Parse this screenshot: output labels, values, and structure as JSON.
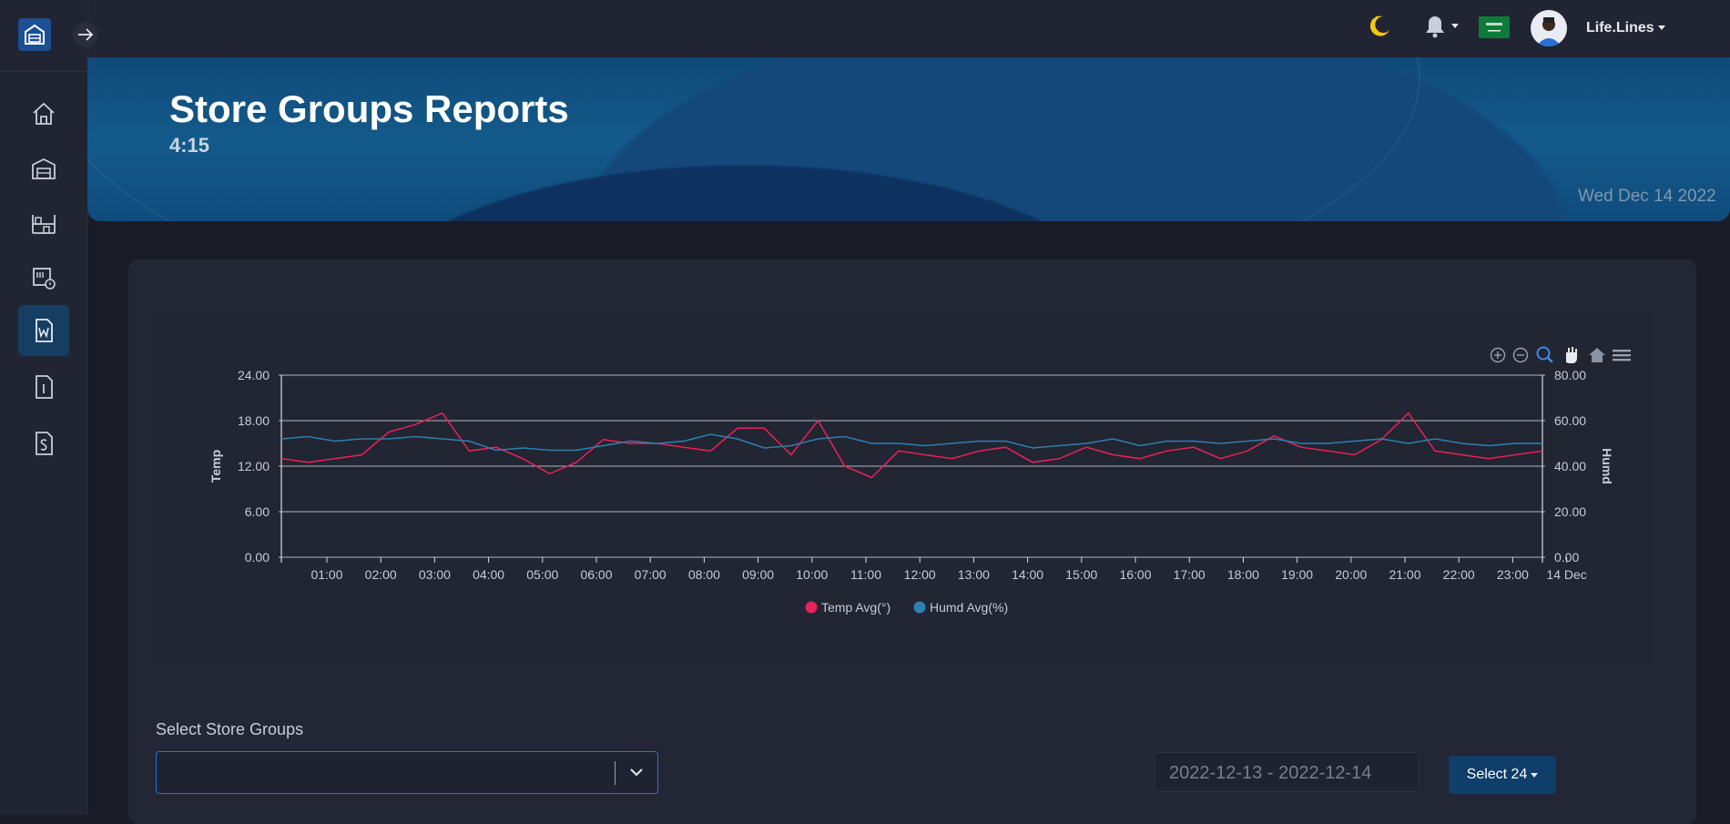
{
  "header": {
    "user_name": "Life.Lines",
    "icons": [
      "moon-icon",
      "bell-icon",
      "flag-icon",
      "avatar",
      "menu-toggle-icon"
    ]
  },
  "sidebar": {
    "items": [
      {
        "icon": "home-icon",
        "active": false
      },
      {
        "icon": "warehouse-icon",
        "active": false
      },
      {
        "icon": "storage-icon",
        "active": false
      },
      {
        "icon": "devices-icon",
        "active": false
      },
      {
        "icon": "report-w-icon",
        "active": true
      },
      {
        "icon": "report-i-icon",
        "active": false
      },
      {
        "icon": "report-s-icon",
        "active": false
      }
    ]
  },
  "banner": {
    "title": "Store Groups Reports",
    "time": "4:15",
    "date": "Wed Dec 14 2022"
  },
  "chart_data": {
    "type": "line",
    "x": [
      "01:00",
      "02:00",
      "03:00",
      "04:00",
      "05:00",
      "06:00",
      "07:00",
      "08:00",
      "09:00",
      "10:00",
      "11:00",
      "12:00",
      "13:00",
      "14:00",
      "15:00",
      "16:00",
      "17:00",
      "18:00",
      "19:00",
      "20:00",
      "21:00",
      "22:00",
      "23:00",
      "14 Dec"
    ],
    "y_left": {
      "label": "Temp",
      "ticks": [
        "24.00",
        "18.00",
        "12.00",
        "6.00",
        "0.00"
      ],
      "range": [
        0,
        24
      ]
    },
    "y_right": {
      "label": "Humd",
      "ticks": [
        "80.00",
        "60.00",
        "40.00",
        "20.00",
        "0.00"
      ],
      "range": [
        0,
        80
      ]
    },
    "series": [
      {
        "name": "Temp Avg(°)",
        "color": "#e8225a",
        "axis": "left",
        "values": [
          13.0,
          12.5,
          13.0,
          13.5,
          16.5,
          17.5,
          19.0,
          14.0,
          14.5,
          13.0,
          11.0,
          12.5,
          15.5,
          15.0,
          15.0,
          14.5,
          14.0,
          17.0,
          17.0,
          13.5,
          18.0,
          12.0,
          10.5,
          14.0,
          13.5,
          13.0,
          14.0,
          14.5,
          12.5,
          13.0,
          14.5,
          13.5,
          13.0,
          14.0,
          14.5,
          13.0,
          14.0,
          16.0,
          14.5,
          14.0,
          13.5,
          15.5,
          19.0,
          14.0,
          13.5,
          13.0,
          13.5,
          14.0
        ]
      },
      {
        "name": "Humd Avg(%)",
        "color": "#2f7fb0",
        "axis": "right",
        "values": [
          52,
          53,
          51,
          52,
          52,
          53,
          52,
          51,
          47,
          48,
          47,
          47,
          49,
          51,
          50,
          51,
          54,
          52,
          48,
          49,
          52,
          53,
          50,
          50,
          49,
          50,
          51,
          51,
          48,
          49,
          50,
          52,
          49,
          51,
          51,
          50,
          51,
          52,
          50,
          50,
          51,
          52,
          50,
          52,
          50,
          49,
          50,
          50
        ]
      }
    ],
    "toolbar": [
      "zoom-in-icon",
      "zoom-out-icon",
      "selection-zoom-icon",
      "pan-icon",
      "reset-home-icon",
      "menu-icon"
    ],
    "legend_position": "bottom",
    "grid": true
  },
  "controls": {
    "select_label": "Select Store Groups",
    "select_value": "",
    "date_range": "2022-12-13 - 2022-12-14",
    "select24_label": "Select 24"
  }
}
